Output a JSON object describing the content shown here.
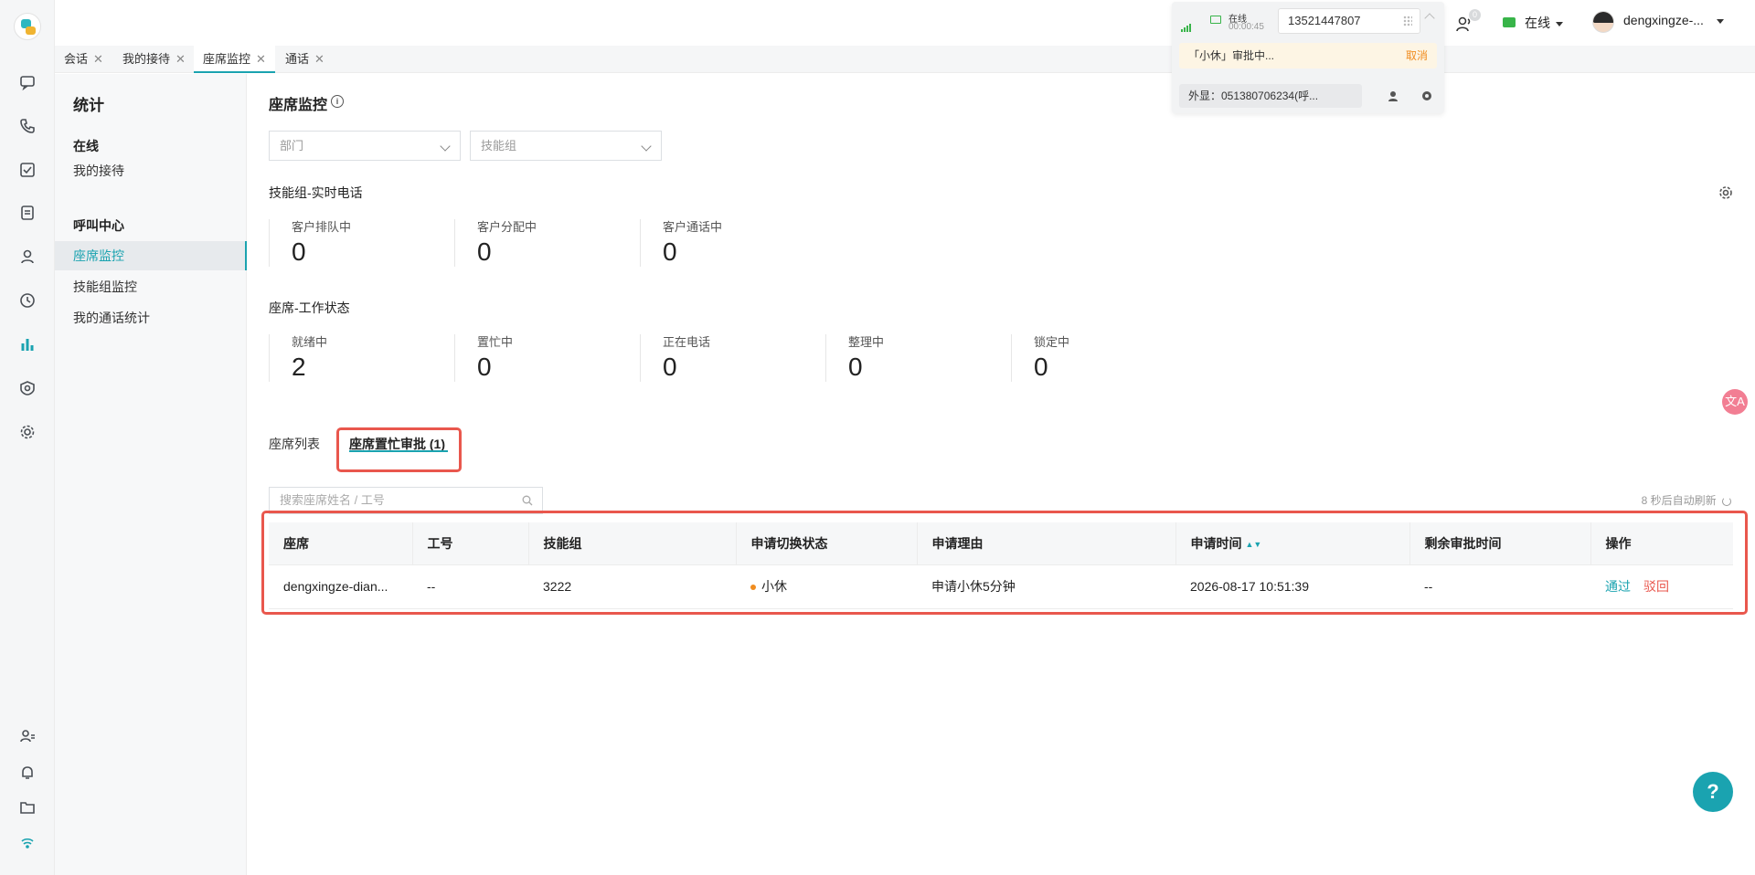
{
  "tabs": [
    {
      "label": "会话"
    },
    {
      "label": "我的接待"
    },
    {
      "label": "座席监控"
    },
    {
      "label": "通话"
    }
  ],
  "tab_close": "✕",
  "subnav": {
    "title": "统计",
    "group1": "在线",
    "item1": "我的接待",
    "group2": "呼叫中心",
    "item2": "座席监控",
    "item3": "技能组监控",
    "item4": "我的通话统计"
  },
  "main": {
    "page_title": "座席监控",
    "info_glyph": "i",
    "filter_dept_placeholder": "部门",
    "filter_skill_placeholder": "技能组",
    "section1_title": "技能组-实时电话",
    "section1_stats": [
      {
        "label": "客户排队中",
        "value": "0"
      },
      {
        "label": "客户分配中",
        "value": "0"
      },
      {
        "label": "客户通话中",
        "value": "0"
      }
    ],
    "section2_title": "座席-工作状态",
    "section2_stats": [
      {
        "label": "就绪中",
        "value": "2"
      },
      {
        "label": "置忙中",
        "value": "0"
      },
      {
        "label": "正在电话",
        "value": "0"
      },
      {
        "label": "整理中",
        "value": "0"
      },
      {
        "label": "锁定中",
        "value": "0"
      }
    ],
    "lower_tab1": "座席列表",
    "lower_tab2": "座席置忙审批 (1)",
    "search_placeholder": "搜索座席姓名 / 工号",
    "auto_refresh": "8 秒后自动刷新",
    "table": {
      "headers": [
        "座席",
        "工号",
        "技能组",
        "申请切换状态",
        "申请理由",
        "申请时间",
        "剩余审批时间",
        "操作"
      ],
      "rows": [
        {
          "agent": "dengxingze-dian...",
          "id": "--",
          "skill_group": "3222",
          "status": "小休",
          "reason": "申请小休5分钟",
          "time": "2026-08-17 10:51:39",
          "remaining": "--",
          "approve": "通过",
          "reject": "驳回"
        }
      ]
    }
  },
  "call_panel": {
    "status": "在线",
    "timer": "00:00:45",
    "phone_number": "13521447807",
    "approval_text": "「小休」审批中...",
    "cancel": "取消",
    "caller_id": "外显：051380706234(呼..."
  },
  "header": {
    "badge": "0",
    "status": "在线",
    "username": "dengxingze-..."
  },
  "floating": {
    "translate": "文A",
    "help": "?"
  },
  "colors": {
    "accent": "#1aa3b0",
    "highlight_box": "#e9574d",
    "online_green": "#38b449",
    "warn_orange": "#f08c1f"
  }
}
